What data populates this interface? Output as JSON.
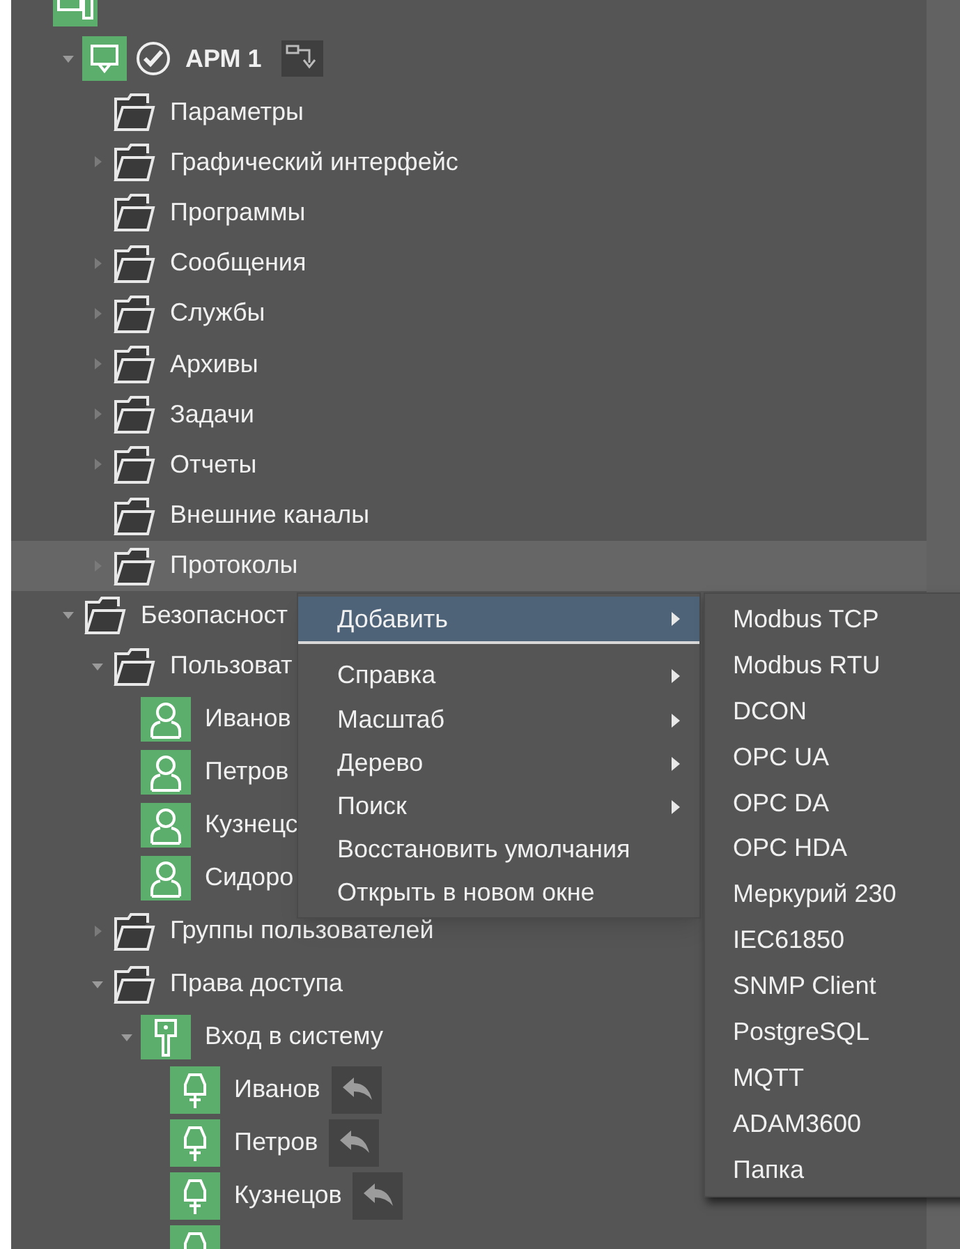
{
  "tree": [
    {
      "kind": "system",
      "children": [
        {
          "label": "АРМ 1",
          "kind": "workstation",
          "expanded": true,
          "checked": true,
          "children": [
            {
              "label": "Параметры",
              "kind": "folder"
            },
            {
              "label": "Графический интерфейс",
              "kind": "folder",
              "expanded": false
            },
            {
              "label": "Программы",
              "kind": "folder"
            },
            {
              "label": "Сообщения",
              "kind": "folder",
              "expanded": false
            },
            {
              "label": "Службы",
              "kind": "folder",
              "expanded": false
            },
            {
              "label": "Архивы",
              "kind": "folder",
              "expanded": false
            },
            {
              "label": "Задачи",
              "kind": "folder",
              "expanded": false
            },
            {
              "label": "Отчеты",
              "kind": "folder",
              "expanded": false
            },
            {
              "label": "Внешние каналы",
              "kind": "folder"
            },
            {
              "label": "Протоколы",
              "kind": "folder",
              "expanded": false,
              "selected": true
            }
          ]
        },
        {
          "label": "Безопасност",
          "kind": "folder",
          "expanded": true,
          "children": [
            {
              "label": "Пользоват",
              "kind": "folder",
              "expanded": true,
              "children": [
                {
                  "label": "Иванов",
                  "kind": "user"
                },
                {
                  "label": "Петров",
                  "kind": "user"
                },
                {
                  "label": "Кузнецс",
                  "kind": "user"
                },
                {
                  "label": "Сидоро",
                  "kind": "user"
                }
              ]
            },
            {
              "label": "Группы пользователей",
              "kind": "folder",
              "expanded": false
            },
            {
              "label": "Права доступа",
              "kind": "folder",
              "expanded": true,
              "children": [
                {
                  "label": "Вход в систему",
                  "kind": "key",
                  "expanded": true,
                  "children": [
                    {
                      "label": "Иванов",
                      "kind": "login"
                    },
                    {
                      "label": "Петров",
                      "kind": "login"
                    },
                    {
                      "label": "Кузнецов",
                      "kind": "login"
                    },
                    {
                      "kind": "login"
                    }
                  ]
                }
              ]
            }
          ]
        }
      ]
    }
  ],
  "context_menu": {
    "items": [
      {
        "label": "Добавить",
        "submenu": true,
        "selected": true
      },
      {
        "label": "Справка",
        "submenu": true,
        "selected": false
      },
      {
        "label": "Масштаб",
        "submenu": true,
        "selected": false
      },
      {
        "label": "Дерево",
        "submenu": true,
        "selected": false
      },
      {
        "label": "Поиск",
        "submenu": true,
        "selected": false
      },
      {
        "label": "Восстановить умолчания",
        "submenu": false,
        "selected": false
      },
      {
        "label": "Открыть в новом окне",
        "submenu": false,
        "selected": false
      }
    ]
  },
  "submenu": {
    "items": [
      "Modbus TCP",
      "Modbus RTU",
      "DCON",
      "OPC UA",
      "OPC DA",
      "OPC HDA",
      "Меркурий 230",
      "IEC61850",
      "SNMP Client",
      "PostgreSQL",
      "MQTT",
      "ADAM3600",
      "Папка"
    ]
  }
}
